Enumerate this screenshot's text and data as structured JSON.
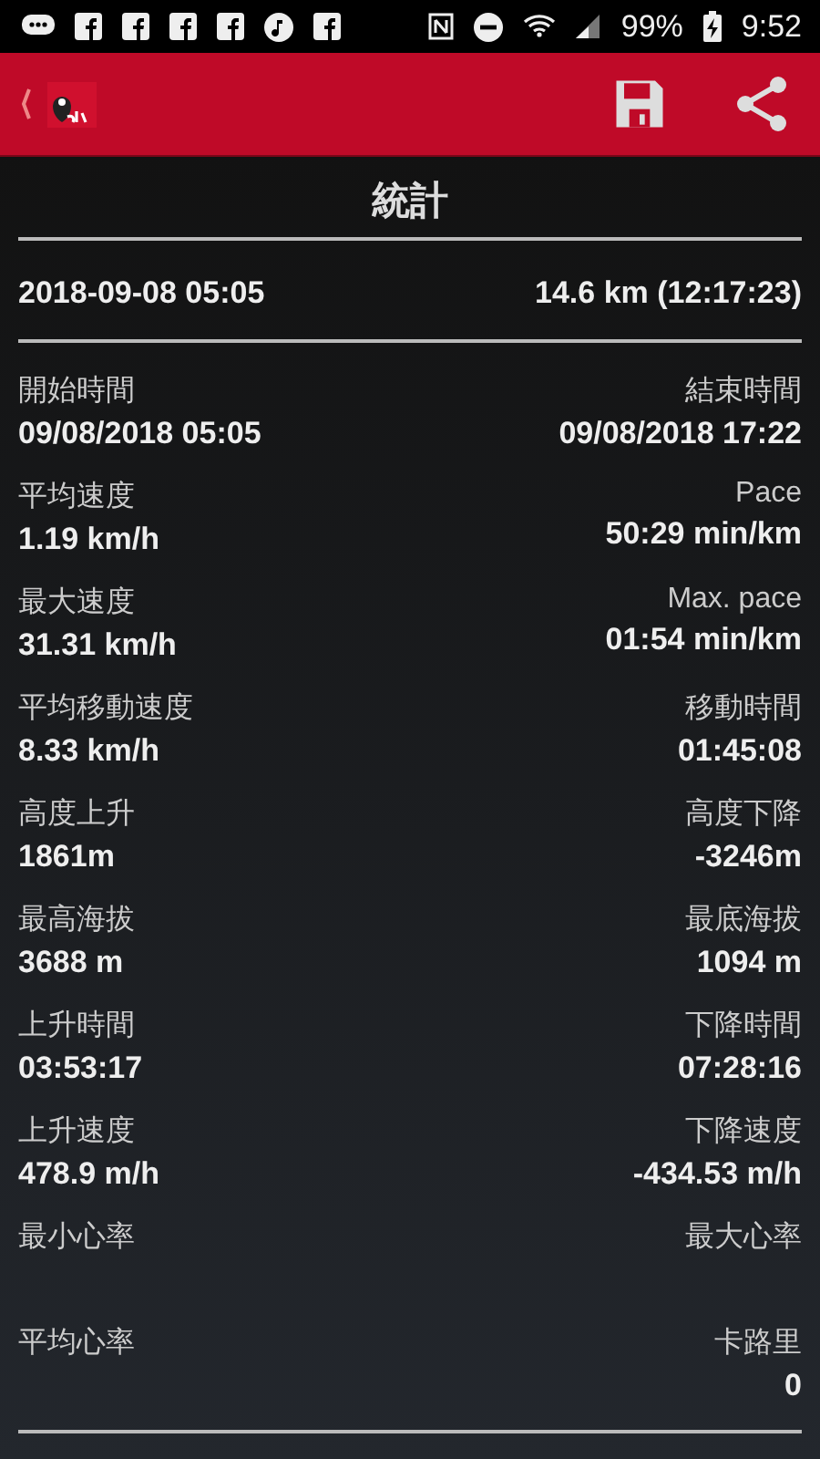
{
  "status_bar": {
    "battery": "99%",
    "time": "9:52"
  },
  "title": "統計",
  "summary": {
    "date": "2018-09-08 05:05",
    "distance": "14.6 km (12:17:23)"
  },
  "rows": [
    {
      "left": {
        "label": "開始時間",
        "value": "09/08/2018 05:05"
      },
      "right": {
        "label": "結束時間",
        "value": "09/08/2018 17:22"
      }
    },
    {
      "left": {
        "label": "平均速度",
        "value": "1.19 km/h"
      },
      "right": {
        "label": "Pace",
        "value": "50:29 min/km"
      }
    },
    {
      "left": {
        "label": "最大速度",
        "value": "31.31 km/h"
      },
      "right": {
        "label": "Max. pace",
        "value": "01:54 min/km"
      }
    },
    {
      "left": {
        "label": "平均移動速度",
        "value": "8.33 km/h"
      },
      "right": {
        "label": "移動時間",
        "value": "01:45:08"
      }
    },
    {
      "left": {
        "label": "高度上升",
        "value": "1861m"
      },
      "right": {
        "label": "高度下降",
        "value": "-3246m"
      }
    },
    {
      "left": {
        "label": "最高海拔",
        "value": "3688 m"
      },
      "right": {
        "label": "最底海拔",
        "value": "1094 m"
      }
    },
    {
      "left": {
        "label": "上升時間",
        "value": "03:53:17"
      },
      "right": {
        "label": "下降時間",
        "value": "07:28:16"
      }
    },
    {
      "left": {
        "label": "上升速度",
        "value": "478.9 m/h"
      },
      "right": {
        "label": "下降速度",
        "value": "-434.53 m/h"
      }
    },
    {
      "left": {
        "label": "最小心率"
      },
      "right": {
        "label": "最大心率"
      }
    },
    {
      "left": {
        "label": "平均心率"
      },
      "right": {
        "label": "卡路里",
        "value": "0"
      }
    }
  ]
}
